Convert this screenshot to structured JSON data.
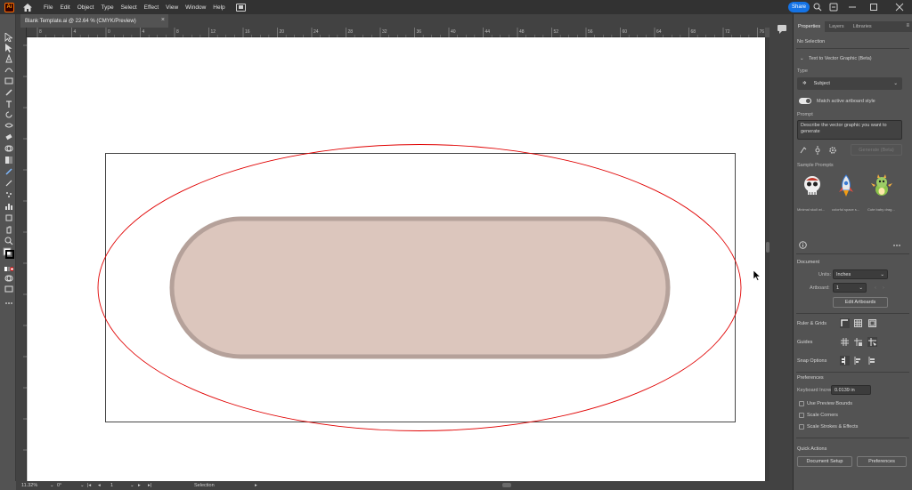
{
  "menubar": {
    "logo": "Ai",
    "items": [
      "File",
      "Edit",
      "Object",
      "Type",
      "Select",
      "Effect",
      "View",
      "Window",
      "Help"
    ],
    "share_label": "Share"
  },
  "document": {
    "tab_title": "Blank Template.ai @ 22.64 % (CMYK/Preview)",
    "tab_close": "×"
  },
  "rulers": {
    "top_labels": [
      "8",
      "4",
      "0",
      "4",
      "8",
      "12",
      "16",
      "20",
      "24",
      "28",
      "32",
      "36",
      "40",
      "44",
      "48",
      "52",
      "56",
      "60",
      "64",
      "68",
      "72",
      "76"
    ]
  },
  "statusbar": {
    "zoom": "11.32%",
    "rotation": "0°",
    "artboard_nav": "1",
    "tool_name": "Selection"
  },
  "panel": {
    "tabs": [
      "Properties",
      "Layers",
      "Libraries"
    ],
    "no_selection": "No Selection",
    "t2v": {
      "title": "Text to Vector Graphic (Beta)",
      "type_label": "Type",
      "type_value": "Subject",
      "match_style": "Match active artboard style",
      "prompt_label": "Prompt",
      "prompt_placeholder": "Describe the vector graphic you want to generate",
      "generate_label": "Generate (Beta)",
      "sample_label": "Sample Prompts",
      "samples": [
        "Minimal skull wi...",
        "colorful space s...",
        "Cute baby drag..."
      ]
    },
    "document": {
      "header": "Document",
      "units_label": "Units:",
      "units_value": "Inches",
      "artboard_label": "Artboard:",
      "artboard_value": "1",
      "edit_artboards": "Edit Artboards"
    },
    "ruler_grids": "Ruler & Grids",
    "guides": "Guides",
    "snap_options": "Snap Options",
    "preferences": {
      "header": "Preferences",
      "keyboard_increment_label": "Keyboard Increment:",
      "keyboard_increment_value": "0.0139 in",
      "use_preview_bounds": "Use Preview Bounds",
      "scale_corners": "Scale Corners",
      "scale_strokes": "Scale Strokes & Effects"
    },
    "quick_actions": {
      "header": "Quick Actions",
      "document_setup": "Document Setup",
      "preferences_btn": "Preferences"
    }
  },
  "colors": {
    "accent": "#1473e6",
    "pill_fill": "#dcc6bd",
    "pill_stroke": "#b5a19a",
    "ellipse_stroke": "#e00000",
    "artboard_stroke": "#333333"
  }
}
